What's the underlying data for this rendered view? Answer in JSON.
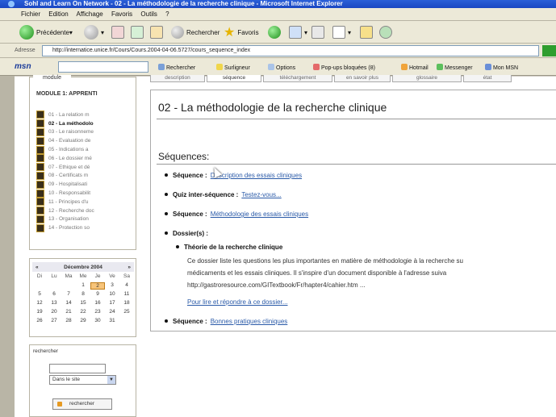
{
  "window": {
    "title": "Sohl and Learn On Network - 02 - La méthodologie de la recherche clinique - Microsoft Internet Explorer"
  },
  "menu": [
    "Fichier",
    "Edition",
    "Affichage",
    "Favoris",
    "Outils",
    "?"
  ],
  "toolbar": {
    "back": "Précédente",
    "search": "Rechercher",
    "favorites": "Favoris"
  },
  "address": {
    "label": "Adresse",
    "url": "http://internatice.unice.fr/Cours/Cours.2004-04-06.5727/cours_sequence_index"
  },
  "msn": {
    "logo": "msn",
    "items": [
      "Rechercher",
      "Surligneur",
      "Options",
      "Pop-ups bloquées (8)",
      "Hotmail",
      "Messenger",
      "Mon MSN"
    ]
  },
  "tabs": [
    "description",
    "séquence",
    "téléchargement",
    "en savoir plus",
    "glossaire",
    "état"
  ],
  "sidebar": {
    "module_tab": "module",
    "module_title": "MODULE 1: APPRENTI",
    "items": [
      "01 - La relation m",
      "02 - La méthodolo",
      "03 - Le raisonneme",
      "04 - Evaluation de",
      "05 - Indications a",
      "06 - Le dossier mé",
      "07 - Ethique et dé",
      "08 - Certificats m",
      "09 - Hospitalisati",
      "10 - Responsabilit",
      "11 - Principes d'u",
      "12 - Recherche doc",
      "13 - Organisation",
      "14 - Protection so"
    ],
    "active_index": 1
  },
  "calendar": {
    "prev": "«",
    "next": "»",
    "month": "Décembre 2004",
    "days": [
      "Di",
      "Lu",
      "Ma",
      "Me",
      "Je",
      "Ve",
      "Sa"
    ],
    "weeks": [
      [
        "",
        "",
        "",
        "1",
        "2",
        "3",
        "4"
      ],
      [
        "5",
        "6",
        "7",
        "8",
        "9",
        "10",
        "11"
      ],
      [
        "12",
        "13",
        "14",
        "15",
        "16",
        "17",
        "18"
      ],
      [
        "19",
        "20",
        "21",
        "22",
        "23",
        "24",
        "25"
      ],
      [
        "26",
        "27",
        "28",
        "29",
        "30",
        "31",
        ""
      ]
    ],
    "today": "2"
  },
  "search": {
    "label": "rechercher",
    "scope": "Dans le site",
    "button": "rechercher"
  },
  "content": {
    "title": "02 - La méthodologie de la recherche clinique",
    "sequences_heading": "Séquences:",
    "items": [
      {
        "label": "Séquence :",
        "link": "Description des essais cliniques"
      },
      {
        "label": "Quiz inter-séquence :",
        "link": "Testez-vous..."
      },
      {
        "label": "Séquence :",
        "link": "Méthodologie des essais cliniques"
      },
      {
        "label": "Dossier(s) :",
        "link": ""
      }
    ],
    "dossier": {
      "title": "Théorie de la recherche clinique",
      "line1": "Ce dossier liste les questions les plus importantes en matière de méthodologie à la recherche su",
      "line2": "médicaments et les essais cliniques. Il s'inspire d'un document disponible à l'adresse suiva",
      "line3": "http://gastroresource.com/GITextbook/Fr/hapter4/cahier.htm ...",
      "link": "Pour lire et répondre à ce dossier..."
    },
    "last": {
      "label": "Séquence :",
      "link": "Bonnes pratiques cliniques"
    }
  }
}
